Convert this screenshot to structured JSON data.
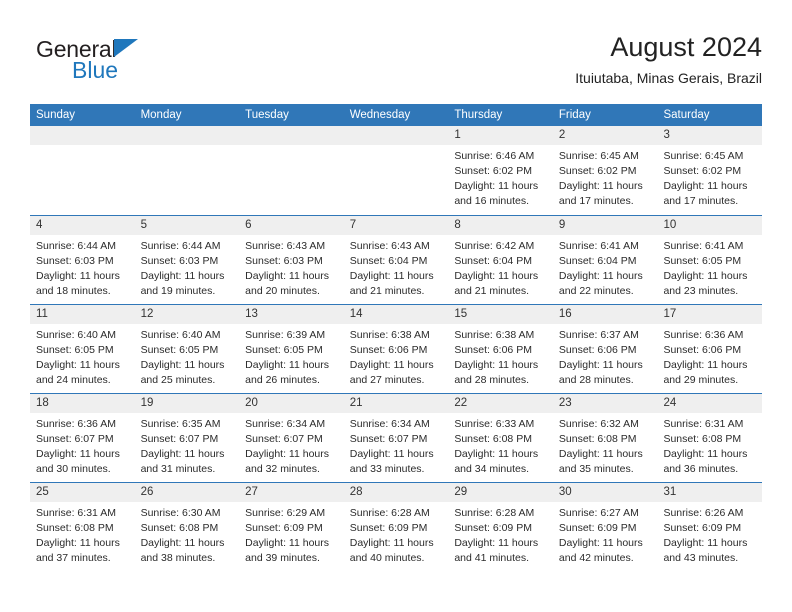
{
  "brand": {
    "word_one": "General",
    "word_two": "Blue",
    "triangle_icon": "triangle-icon",
    "accent_color": "#1f77bc"
  },
  "header": {
    "title": "August 2024",
    "subtitle": "Ituiutaba, Minas Gerais, Brazil"
  },
  "colors": {
    "header_blue": "#3077b8",
    "day_strip": "#efefef",
    "text": "#2b2b2b"
  },
  "weekdays": [
    "Sunday",
    "Monday",
    "Tuesday",
    "Wednesday",
    "Thursday",
    "Friday",
    "Saturday"
  ],
  "weeks": [
    [
      {
        "day": "",
        "sunrise": "",
        "sunset": "",
        "daylight_line1": "",
        "daylight_line2": ""
      },
      {
        "day": "",
        "sunrise": "",
        "sunset": "",
        "daylight_line1": "",
        "daylight_line2": ""
      },
      {
        "day": "",
        "sunrise": "",
        "sunset": "",
        "daylight_line1": "",
        "daylight_line2": ""
      },
      {
        "day": "",
        "sunrise": "",
        "sunset": "",
        "daylight_line1": "",
        "daylight_line2": ""
      },
      {
        "day": "1",
        "sunrise": "Sunrise: 6:46 AM",
        "sunset": "Sunset: 6:02 PM",
        "daylight_line1": "Daylight: 11 hours",
        "daylight_line2": "and 16 minutes."
      },
      {
        "day": "2",
        "sunrise": "Sunrise: 6:45 AM",
        "sunset": "Sunset: 6:02 PM",
        "daylight_line1": "Daylight: 11 hours",
        "daylight_line2": "and 17 minutes."
      },
      {
        "day": "3",
        "sunrise": "Sunrise: 6:45 AM",
        "sunset": "Sunset: 6:02 PM",
        "daylight_line1": "Daylight: 11 hours",
        "daylight_line2": "and 17 minutes."
      }
    ],
    [
      {
        "day": "4",
        "sunrise": "Sunrise: 6:44 AM",
        "sunset": "Sunset: 6:03 PM",
        "daylight_line1": "Daylight: 11 hours",
        "daylight_line2": "and 18 minutes."
      },
      {
        "day": "5",
        "sunrise": "Sunrise: 6:44 AM",
        "sunset": "Sunset: 6:03 PM",
        "daylight_line1": "Daylight: 11 hours",
        "daylight_line2": "and 19 minutes."
      },
      {
        "day": "6",
        "sunrise": "Sunrise: 6:43 AM",
        "sunset": "Sunset: 6:03 PM",
        "daylight_line1": "Daylight: 11 hours",
        "daylight_line2": "and 20 minutes."
      },
      {
        "day": "7",
        "sunrise": "Sunrise: 6:43 AM",
        "sunset": "Sunset: 6:04 PM",
        "daylight_line1": "Daylight: 11 hours",
        "daylight_line2": "and 21 minutes."
      },
      {
        "day": "8",
        "sunrise": "Sunrise: 6:42 AM",
        "sunset": "Sunset: 6:04 PM",
        "daylight_line1": "Daylight: 11 hours",
        "daylight_line2": "and 21 minutes."
      },
      {
        "day": "9",
        "sunrise": "Sunrise: 6:41 AM",
        "sunset": "Sunset: 6:04 PM",
        "daylight_line1": "Daylight: 11 hours",
        "daylight_line2": "and 22 minutes."
      },
      {
        "day": "10",
        "sunrise": "Sunrise: 6:41 AM",
        "sunset": "Sunset: 6:05 PM",
        "daylight_line1": "Daylight: 11 hours",
        "daylight_line2": "and 23 minutes."
      }
    ],
    [
      {
        "day": "11",
        "sunrise": "Sunrise: 6:40 AM",
        "sunset": "Sunset: 6:05 PM",
        "daylight_line1": "Daylight: 11 hours",
        "daylight_line2": "and 24 minutes."
      },
      {
        "day": "12",
        "sunrise": "Sunrise: 6:40 AM",
        "sunset": "Sunset: 6:05 PM",
        "daylight_line1": "Daylight: 11 hours",
        "daylight_line2": "and 25 minutes."
      },
      {
        "day": "13",
        "sunrise": "Sunrise: 6:39 AM",
        "sunset": "Sunset: 6:05 PM",
        "daylight_line1": "Daylight: 11 hours",
        "daylight_line2": "and 26 minutes."
      },
      {
        "day": "14",
        "sunrise": "Sunrise: 6:38 AM",
        "sunset": "Sunset: 6:06 PM",
        "daylight_line1": "Daylight: 11 hours",
        "daylight_line2": "and 27 minutes."
      },
      {
        "day": "15",
        "sunrise": "Sunrise: 6:38 AM",
        "sunset": "Sunset: 6:06 PM",
        "daylight_line1": "Daylight: 11 hours",
        "daylight_line2": "and 28 minutes."
      },
      {
        "day": "16",
        "sunrise": "Sunrise: 6:37 AM",
        "sunset": "Sunset: 6:06 PM",
        "daylight_line1": "Daylight: 11 hours",
        "daylight_line2": "and 28 minutes."
      },
      {
        "day": "17",
        "sunrise": "Sunrise: 6:36 AM",
        "sunset": "Sunset: 6:06 PM",
        "daylight_line1": "Daylight: 11 hours",
        "daylight_line2": "and 29 minutes."
      }
    ],
    [
      {
        "day": "18",
        "sunrise": "Sunrise: 6:36 AM",
        "sunset": "Sunset: 6:07 PM",
        "daylight_line1": "Daylight: 11 hours",
        "daylight_line2": "and 30 minutes."
      },
      {
        "day": "19",
        "sunrise": "Sunrise: 6:35 AM",
        "sunset": "Sunset: 6:07 PM",
        "daylight_line1": "Daylight: 11 hours",
        "daylight_line2": "and 31 minutes."
      },
      {
        "day": "20",
        "sunrise": "Sunrise: 6:34 AM",
        "sunset": "Sunset: 6:07 PM",
        "daylight_line1": "Daylight: 11 hours",
        "daylight_line2": "and 32 minutes."
      },
      {
        "day": "21",
        "sunrise": "Sunrise: 6:34 AM",
        "sunset": "Sunset: 6:07 PM",
        "daylight_line1": "Daylight: 11 hours",
        "daylight_line2": "and 33 minutes."
      },
      {
        "day": "22",
        "sunrise": "Sunrise: 6:33 AM",
        "sunset": "Sunset: 6:08 PM",
        "daylight_line1": "Daylight: 11 hours",
        "daylight_line2": "and 34 minutes."
      },
      {
        "day": "23",
        "sunrise": "Sunrise: 6:32 AM",
        "sunset": "Sunset: 6:08 PM",
        "daylight_line1": "Daylight: 11 hours",
        "daylight_line2": "and 35 minutes."
      },
      {
        "day": "24",
        "sunrise": "Sunrise: 6:31 AM",
        "sunset": "Sunset: 6:08 PM",
        "daylight_line1": "Daylight: 11 hours",
        "daylight_line2": "and 36 minutes."
      }
    ],
    [
      {
        "day": "25",
        "sunrise": "Sunrise: 6:31 AM",
        "sunset": "Sunset: 6:08 PM",
        "daylight_line1": "Daylight: 11 hours",
        "daylight_line2": "and 37 minutes."
      },
      {
        "day": "26",
        "sunrise": "Sunrise: 6:30 AM",
        "sunset": "Sunset: 6:08 PM",
        "daylight_line1": "Daylight: 11 hours",
        "daylight_line2": "and 38 minutes."
      },
      {
        "day": "27",
        "sunrise": "Sunrise: 6:29 AM",
        "sunset": "Sunset: 6:09 PM",
        "daylight_line1": "Daylight: 11 hours",
        "daylight_line2": "and 39 minutes."
      },
      {
        "day": "28",
        "sunrise": "Sunrise: 6:28 AM",
        "sunset": "Sunset: 6:09 PM",
        "daylight_line1": "Daylight: 11 hours",
        "daylight_line2": "and 40 minutes."
      },
      {
        "day": "29",
        "sunrise": "Sunrise: 6:28 AM",
        "sunset": "Sunset: 6:09 PM",
        "daylight_line1": "Daylight: 11 hours",
        "daylight_line2": "and 41 minutes."
      },
      {
        "day": "30",
        "sunrise": "Sunrise: 6:27 AM",
        "sunset": "Sunset: 6:09 PM",
        "daylight_line1": "Daylight: 11 hours",
        "daylight_line2": "and 42 minutes."
      },
      {
        "day": "31",
        "sunrise": "Sunrise: 6:26 AM",
        "sunset": "Sunset: 6:09 PM",
        "daylight_line1": "Daylight: 11 hours",
        "daylight_line2": "and 43 minutes."
      }
    ]
  ]
}
